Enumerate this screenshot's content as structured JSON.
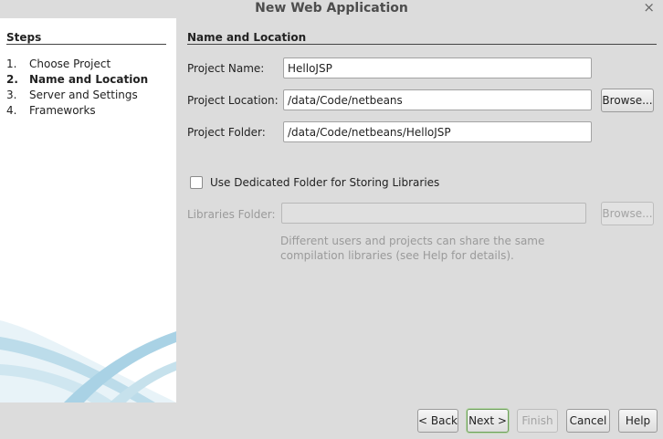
{
  "window": {
    "title": "New Web Application",
    "close_glyph": "×"
  },
  "steps": {
    "title": "Steps",
    "items": [
      {
        "num": "1.",
        "label": "Choose Project"
      },
      {
        "num": "2.",
        "label": "Name and Location"
      },
      {
        "num": "3.",
        "label": "Server and Settings"
      },
      {
        "num": "4.",
        "label": "Frameworks"
      }
    ],
    "active_index": 1
  },
  "content": {
    "title": "Name and Location",
    "project_name_label": "Project Name:",
    "project_name_value": "HelloJSP",
    "project_location_label": "Project Location:",
    "project_location_value": "/data/Code/netbeans",
    "project_folder_label": "Project Folder:",
    "project_folder_value": "/data/Code/netbeans/HelloJSP",
    "browse_label": "Browse...",
    "dedicated_folder_label": "Use Dedicated Folder for Storing Libraries",
    "dedicated_folder_checked": false,
    "libraries_folder_label": "Libraries Folder:",
    "libraries_folder_value": "",
    "libraries_browse_label": "Browse...",
    "hint_line1": "Different users and projects can share the same",
    "hint_line2": "compilation libraries (see Help for details)."
  },
  "footer": {
    "back_label": "< Back",
    "next_label": "Next >",
    "finish_label": "Finish",
    "cancel_label": "Cancel",
    "help_label": "Help"
  },
  "colors": {
    "background": "#dcdcdc",
    "panel": "#ffffff",
    "swoosh": "#a9d2e5",
    "focus": "#6e9e5c"
  }
}
